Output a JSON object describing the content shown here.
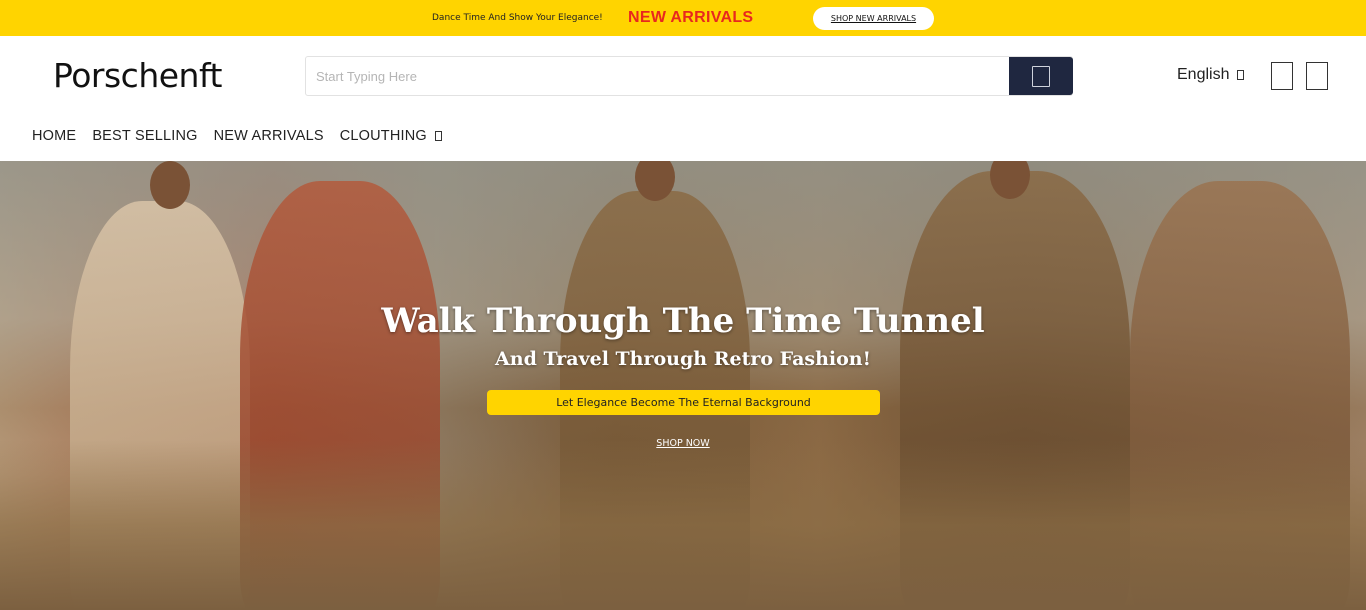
{
  "announcement": {
    "tagline": "Dance Time And Show Your Elegance!",
    "headline": "NEW ARRIVALS",
    "cta": "SHOP NEW ARRIVALS",
    "bg_color": "#ffd400",
    "headline_color": "#e8281e"
  },
  "header": {
    "logo": "Porschenft",
    "search": {
      "placeholder": "Start Typing Here",
      "value": ""
    },
    "search_button_icon": "search-icon",
    "language": "English",
    "icons": [
      "account-icon",
      "cart-icon"
    ],
    "accent_color": "#1f2740"
  },
  "nav": {
    "items": [
      {
        "label": "HOME"
      },
      {
        "label": "BEST SELLING"
      },
      {
        "label": "NEW ARRIVALS"
      },
      {
        "label": "CLOUTHING",
        "has_dropdown": true
      }
    ]
  },
  "hero": {
    "title": "Walk Through The Time Tunnel",
    "subtitle": "And Travel Through Retro Fashion!",
    "tag": "Let Elegance Become The Eternal Background",
    "cta": "SHOP NOW",
    "tag_color": "#ffd400"
  }
}
